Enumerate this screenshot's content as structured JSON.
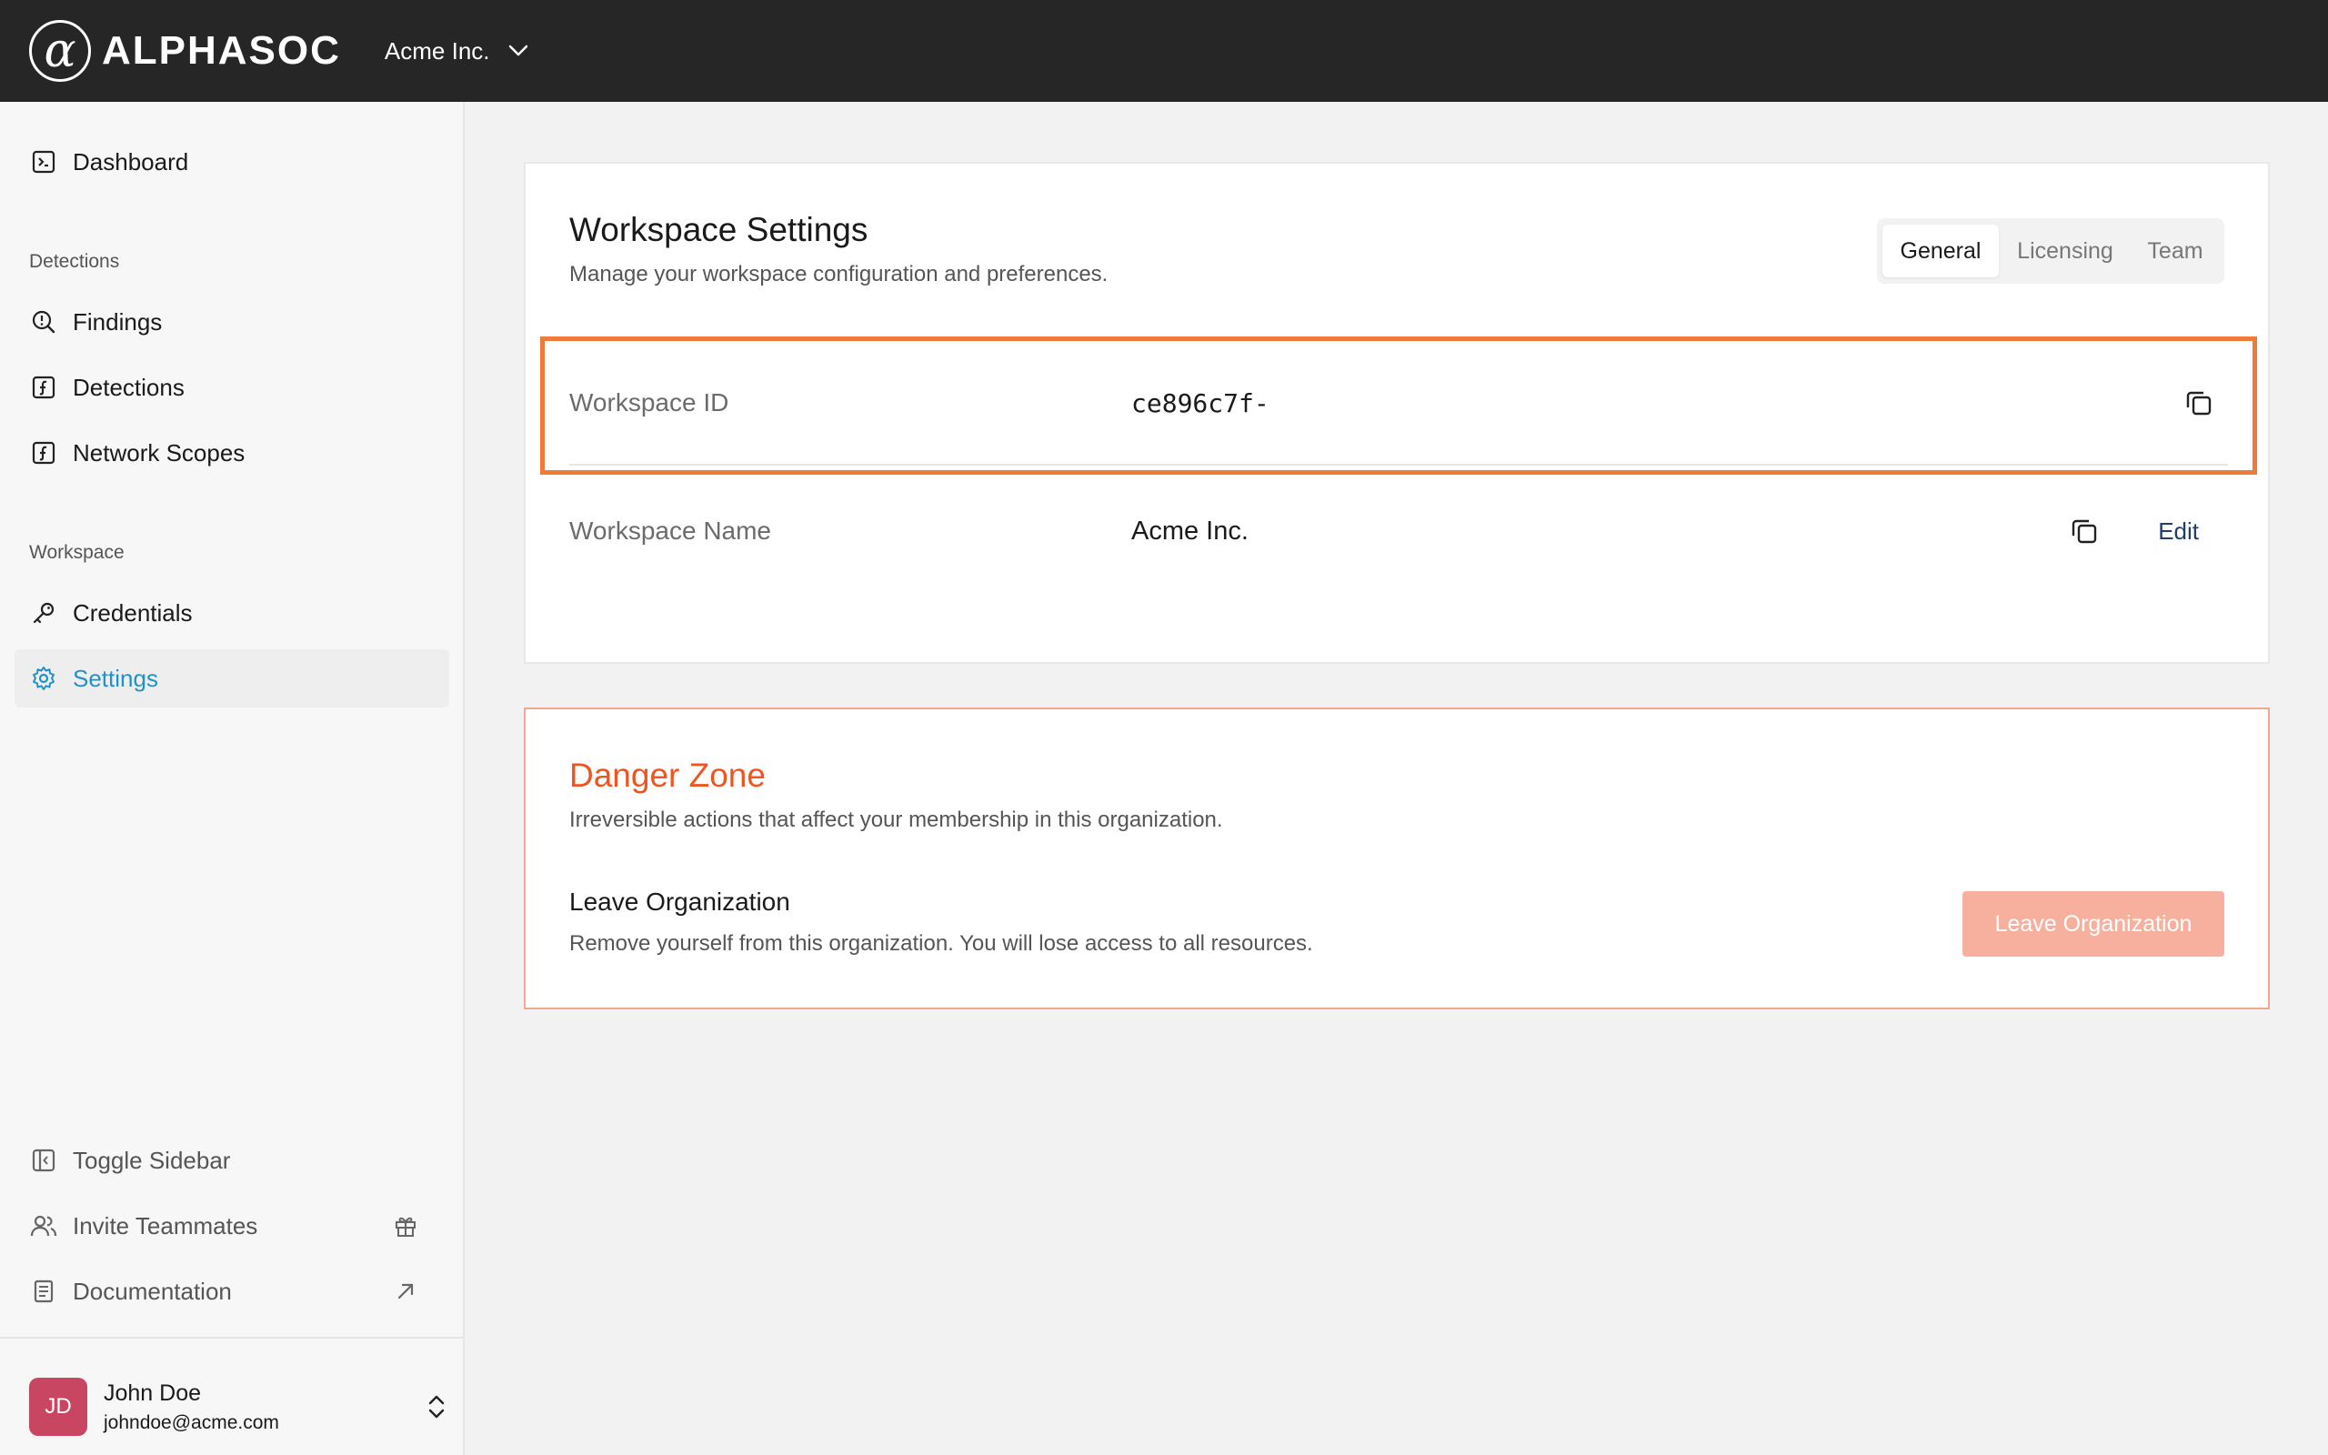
{
  "header": {
    "logo_symbol": "α",
    "logo_text": "ALPHASOC",
    "org_name": "Acme Inc."
  },
  "sidebar": {
    "dashboard": "Dashboard",
    "detections_section": "Detections",
    "findings": "Findings",
    "detections": "Detections",
    "network_scopes": "Network Scopes",
    "workspace_section": "Workspace",
    "credentials": "Credentials",
    "settings": "Settings",
    "toggle_sidebar": "Toggle Sidebar",
    "invite_teammates": "Invite Teammates",
    "documentation": "Documentation",
    "active_item": "Settings"
  },
  "user": {
    "initials": "JD",
    "name": "John Doe",
    "email": "johndoe@acme.com"
  },
  "settings_card": {
    "title": "Workspace Settings",
    "subtitle": "Manage your workspace configuration and preferences.",
    "tabs": [
      "General",
      "Licensing",
      "Team"
    ],
    "active_tab": "General",
    "workspace_id_label": "Workspace ID",
    "workspace_id_value": "ce896c7f-",
    "workspace_name_label": "Workspace Name",
    "workspace_name_value": "Acme Inc.",
    "edit_label": "Edit"
  },
  "danger_zone": {
    "title": "Danger Zone",
    "subtitle": "Irreversible actions that affect your membership in this organization.",
    "leave_title": "Leave Organization",
    "leave_description": "Remove yourself from this organization. You will lose access to all resources.",
    "leave_button": "Leave Organization"
  },
  "colors": {
    "topbar": "#262626",
    "accent": "#2391c9",
    "danger": "#ee5520",
    "highlight": "#ee7b37",
    "leave_button": "#f7b09d",
    "avatar": "#c84661"
  }
}
